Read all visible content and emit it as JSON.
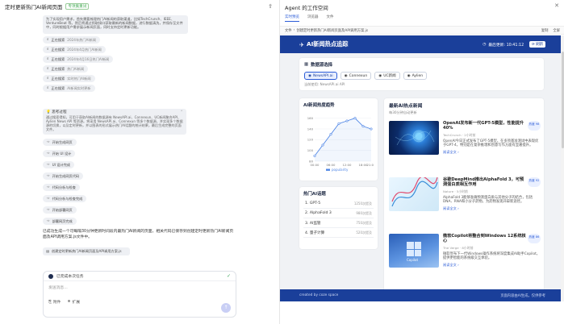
{
  "left": {
    "title": "定时更新热门AI新闻页面",
    "badge": "专项集重试",
    "share_icon": "share-icon",
    "assistant_intro": "为了实现用户需求，首先需要梳理热门AI新闻的获取渠道，比如TechCrunch、IEEE、VentureBeat 等。然后将通过抓取接口获取最新的新闻数据，进行数据清洗，并保存至文件中，同时根据用户需求展示新闻页面，同时支持定时更新功能。",
    "steps": [
      {
        "icon": "search-icon",
        "label": "正在搜索",
        "detail": "2024年热门AI新闻"
      },
      {
        "icon": "search-icon",
        "label": "正在搜索",
        "detail": "2024年4月热门AI新闻"
      },
      {
        "icon": "search-icon",
        "label": "正在搜索",
        "detail": "2024年4月16日热门AI新闻"
      },
      {
        "icon": "search-icon",
        "label": "正在搜索",
        "detail": "热门AI新闻"
      },
      {
        "icon": "search-icon",
        "label": "正在搜索",
        "detail": "实时热门AI新闻"
      },
      {
        "icon": "search-icon",
        "label": "正在搜索",
        "detail": "AI新闻实时更新"
      }
    ],
    "thinking": {
      "title": "思考过程",
      "text": "通过搜索得知，可用于获取AI新闻的数据源有 NewsAPI.ai、Connexun、UC新闻聚合API、Aylien News API 等资源。将采用 NewsAPI.ai、Connexun 等多个数据源，并实现多个数据源的切换，以及定时更新，并以图表的形式展示热门AI话题的统计结果，最后生成完整的页面文件。"
    },
    "actions": [
      {
        "icon": "code-icon",
        "label": "开始生成网页"
      },
      {
        "icon": "code-icon",
        "label": "开始 UI 设计"
      },
      {
        "icon": "code-icon",
        "label": "UI 设计完成"
      },
      {
        "icon": "code-icon",
        "label": "开始生成网页代码"
      },
      {
        "icon": "code-icon",
        "label": "代码分析与检查"
      },
      {
        "icon": "code-icon",
        "label": "代码分析与检查完成"
      },
      {
        "icon": "code-icon",
        "label": "开始部署网页"
      },
      {
        "icon": "code-icon",
        "label": "部署网页完成"
      }
    ],
    "final_text": "已成功生成一个可每隔30分钟更新时间段内最热门AI新闻的页面，相关代码已保存到创建定时更新热门AI新闻页面及API调用方案.js文件中。",
    "file_chip": "创建定时更新热门AI新闻页面及API调用方案.js",
    "input": {
      "task_label": "已完成本次任务",
      "placeholder": "发送消息...",
      "attach_label": "附件",
      "expand_label": "扩展"
    }
  },
  "right": {
    "title": "Agent 的工作空间",
    "tabs": [
      "实时预览",
      "浏览器",
      "文件"
    ],
    "path_label": "文件",
    "path": "创建定时更新热门AI新闻页面及API调用方案.js",
    "actions": [
      "复制",
      "全屏"
    ],
    "webpage": {
      "logo": "AI新闻热点追踪",
      "last_update_label": "最后更新: 10:41:12",
      "refresh_label": "刷新",
      "source_title": "数据源选择",
      "sources": [
        "NewsAPI.ai",
        "Connexun",
        "UC新闻",
        "Aylien"
      ],
      "active_source": "NewsAPI.ai",
      "current_source_text": "当前使用: NewsAPI.ai API",
      "chart_title": "AI新闻热度趋势",
      "chart_legend": "popularity",
      "hot_title": "热门AI话题",
      "hot_topics": [
        {
          "name": "GPT-5",
          "count": "1250次提及"
        },
        {
          "name": "AlphaFold 3",
          "count": "980次提及"
        },
        {
          "name": "AI监管",
          "count": "750次提及"
        },
        {
          "name": "量子计算",
          "count": "520次提及"
        }
      ],
      "news_title": "最新AI热点新闻",
      "news_sub": "每30分钟自动更新",
      "news": [
        {
          "title": "OpenAI发布新一代GPT-5模型，性能提升40%",
          "meta": "TechCrunch · 2小时前",
          "desc": "OpenAI今日正式发布了GPT-5模型，在多项基准测试中表现优于GPT-4，特别是在复杂推理和创意写作方面有显著提升。",
          "more": "阅读全文 ›",
          "tag": "热度 98",
          "image": "ai-brain-image"
        },
        {
          "title": "谷歌DeepMind推出AlphaFold 3，可预测蛋白质相互作用",
          "meta": "Nature · 5小时前",
          "desc": "AlphaFold 3能够准确预测蛋白质与其他分子的结合，包括DNA、RNA和小分子药物，为药物发现开辟新途径。",
          "more": "阅读全文 ›",
          "tag": "热度 92",
          "image": "dna-image"
        },
        {
          "title": "微软Copilot将整合到Windows 12系统核心",
          "meta": "The Verge · 8小时前",
          "desc": "微软宣布下一代Windows操作系统将深度集成AI助手Copilot，提供更智能的系统级交互体验。",
          "more": "阅读全文 ›",
          "tag": "热度 86",
          "image": "windows-copilot-image"
        }
      ],
      "footer_left": "created by coze space",
      "footer_right": "页面内容由AI生成，仅供参考"
    }
  },
  "chart_data": {
    "type": "line",
    "x": [
      "00:00",
      "03:00",
      "06:00",
      "09:00",
      "12:00",
      "15:00",
      "18:00",
      "21:00"
    ],
    "series": [
      {
        "name": "popularity",
        "values": [
          90,
          110,
          130,
          150,
          155,
          160,
          145,
          140
        ]
      }
    ],
    "ylim": [
      80,
      170
    ],
    "yticks": [
      80,
      100,
      120,
      140,
      160
    ],
    "xticks": [
      "00:00",
      "06:00",
      "12:00",
      "18:00",
      "21:00"
    ],
    "color": "#4f86e6",
    "grid": true
  }
}
